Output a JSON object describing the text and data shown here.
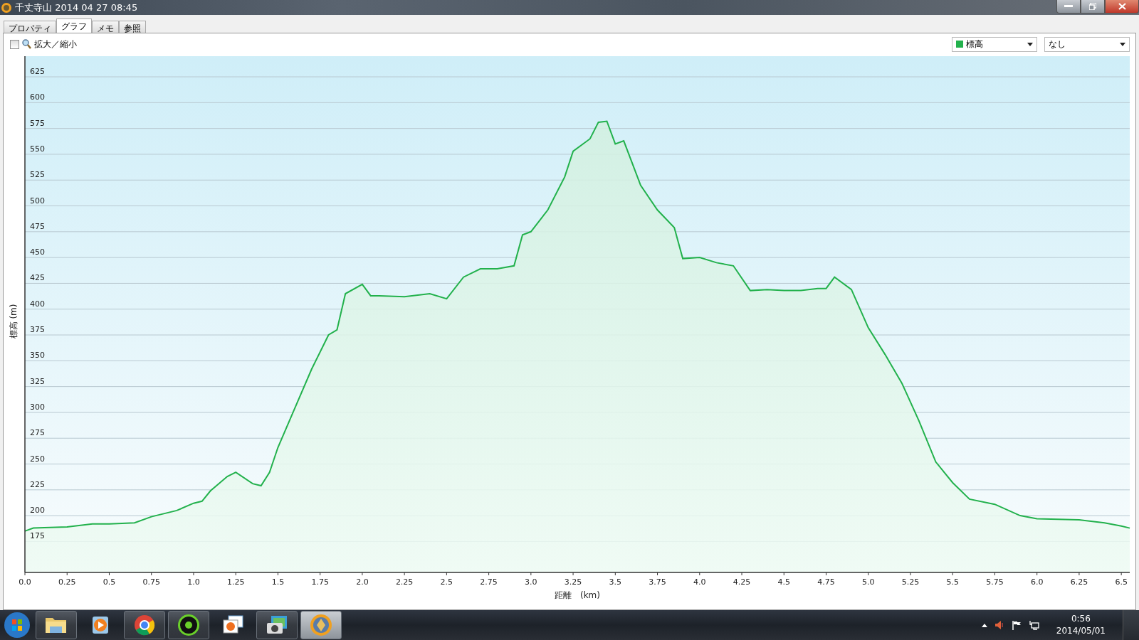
{
  "window": {
    "title": "千丈寺山 2014 04 27 08:45"
  },
  "tabs": [
    {
      "label": "プロパティ",
      "selected": false
    },
    {
      "label": "グラフ",
      "selected": true
    },
    {
      "label": "メモ",
      "selected": false
    },
    {
      "label": "参照",
      "selected": false
    }
  ],
  "toolbar": {
    "zoom_checkbox": {
      "label": "拡大／縮小",
      "checked": false
    },
    "compare_select": {
      "value": "なし"
    }
  },
  "chart_data": {
    "type": "area",
    "grid": true,
    "xlabel": "距離　(km)",
    "ylabel": "標高 (m)",
    "xlim": [
      0,
      6.55
    ],
    "ylim": [
      145,
      645
    ],
    "xticks": [
      {
        "value": 0,
        "label": "0.0"
      },
      0.25,
      0.5,
      0.75,
      {
        "value": 1,
        "label": "1.0"
      },
      1.25,
      1.5,
      1.75,
      {
        "value": 2,
        "label": "2.0"
      },
      2.25,
      2.5,
      2.75,
      {
        "value": 3,
        "label": "3.0"
      },
      3.25,
      3.5,
      3.75,
      {
        "value": 4,
        "label": "4.0"
      },
      4.25,
      4.5,
      4.75,
      {
        "value": 5,
        "label": "5.0"
      },
      5.25,
      5.5,
      5.75,
      {
        "value": 6,
        "label": "6.0"
      },
      6.25,
      6.5
    ],
    "yticks": [
      175,
      200,
      225,
      250,
      275,
      300,
      325,
      350,
      375,
      400,
      425,
      450,
      475,
      500,
      525,
      550,
      575,
      600,
      625
    ],
    "x": [
      0,
      0.05,
      0.25,
      0.4,
      0.5,
      0.65,
      0.75,
      0.9,
      1.0,
      1.05,
      1.1,
      1.2,
      1.25,
      1.35,
      1.4,
      1.45,
      1.5,
      1.6,
      1.7,
      1.8,
      1.85,
      1.9,
      2.0,
      2.05,
      2.1,
      2.25,
      2.4,
      2.5,
      2.6,
      2.7,
      2.8,
      2.9,
      2.95,
      3.0,
      3.1,
      3.2,
      3.25,
      3.35,
      3.4,
      3.45,
      3.5,
      3.55,
      3.65,
      3.75,
      3.85,
      3.9,
      4.0,
      4.1,
      4.2,
      4.3,
      4.4,
      4.5,
      4.6,
      4.7,
      4.75,
      4.8,
      4.9,
      5.0,
      5.1,
      5.2,
      5.3,
      5.4,
      5.5,
      5.6,
      5.75,
      5.9,
      6.0,
      6.25,
      6.4,
      6.5,
      6.55
    ],
    "series": [
      {
        "name": "標高",
        "color": "#22b14c",
        "values": [
          185,
          188,
          189,
          192,
          192,
          193,
          199,
          205,
          212,
          214,
          224,
          238,
          242,
          231,
          229,
          242,
          266,
          304,
          342,
          375,
          380,
          415,
          424,
          413,
          413,
          412,
          415,
          410,
          431,
          439,
          439,
          442,
          472,
          475,
          496,
          528,
          553,
          565,
          581,
          582,
          560,
          563,
          520,
          496,
          479,
          449,
          450,
          445,
          442,
          418,
          419,
          418,
          418,
          420,
          420,
          431,
          419,
          382,
          356,
          328,
          292,
          252,
          232,
          216,
          211,
          200,
          197,
          196,
          193,
          190,
          188
        ]
      }
    ]
  },
  "taskbar": {
    "apps": [
      {
        "kind": "folder",
        "running": true,
        "selected": false
      },
      {
        "kind": "player",
        "running": false,
        "selected": false
      },
      {
        "kind": "browser",
        "running": true,
        "selected": false
      },
      {
        "kind": "gear",
        "running": true,
        "selected": false
      },
      {
        "kind": "photos",
        "running": false,
        "selected": false
      },
      {
        "kind": "camera",
        "running": true,
        "selected": false
      },
      {
        "kind": "compass",
        "running": true,
        "selected": true
      }
    ],
    "clock": {
      "time": "0:56",
      "date": "2014/05/01"
    }
  }
}
